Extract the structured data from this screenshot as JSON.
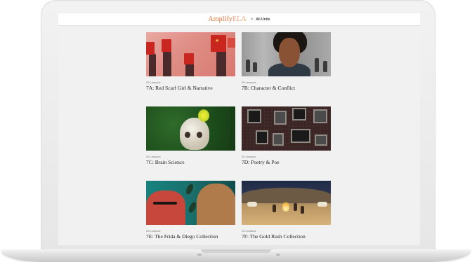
{
  "header": {
    "logo_primary": "Amplify",
    "logo_secondary": "ELA",
    "breadcrumb_separator": ">",
    "breadcrumb_label": "All Units"
  },
  "units": [
    {
      "lessons": "25 Lessons",
      "title": "7A: Red Scarf Girl & Narrative"
    },
    {
      "lessons": "25 Lessons",
      "title": "7B: Character & Conflict"
    },
    {
      "lessons": "25 Lessons",
      "title": "7C: Brain Science"
    },
    {
      "lessons": "25 Lessons",
      "title": "7D: Poetry & Poe"
    },
    {
      "lessons": "25 Lessons",
      "title": "7E: The Frida & Diego Collection"
    },
    {
      "lessons": "25 Lessons",
      "title": "7F: The Gold Rush Collection"
    }
  ],
  "colors": {
    "brand_orange": "#e8743b",
    "screen_background": "#f1f1f1"
  }
}
